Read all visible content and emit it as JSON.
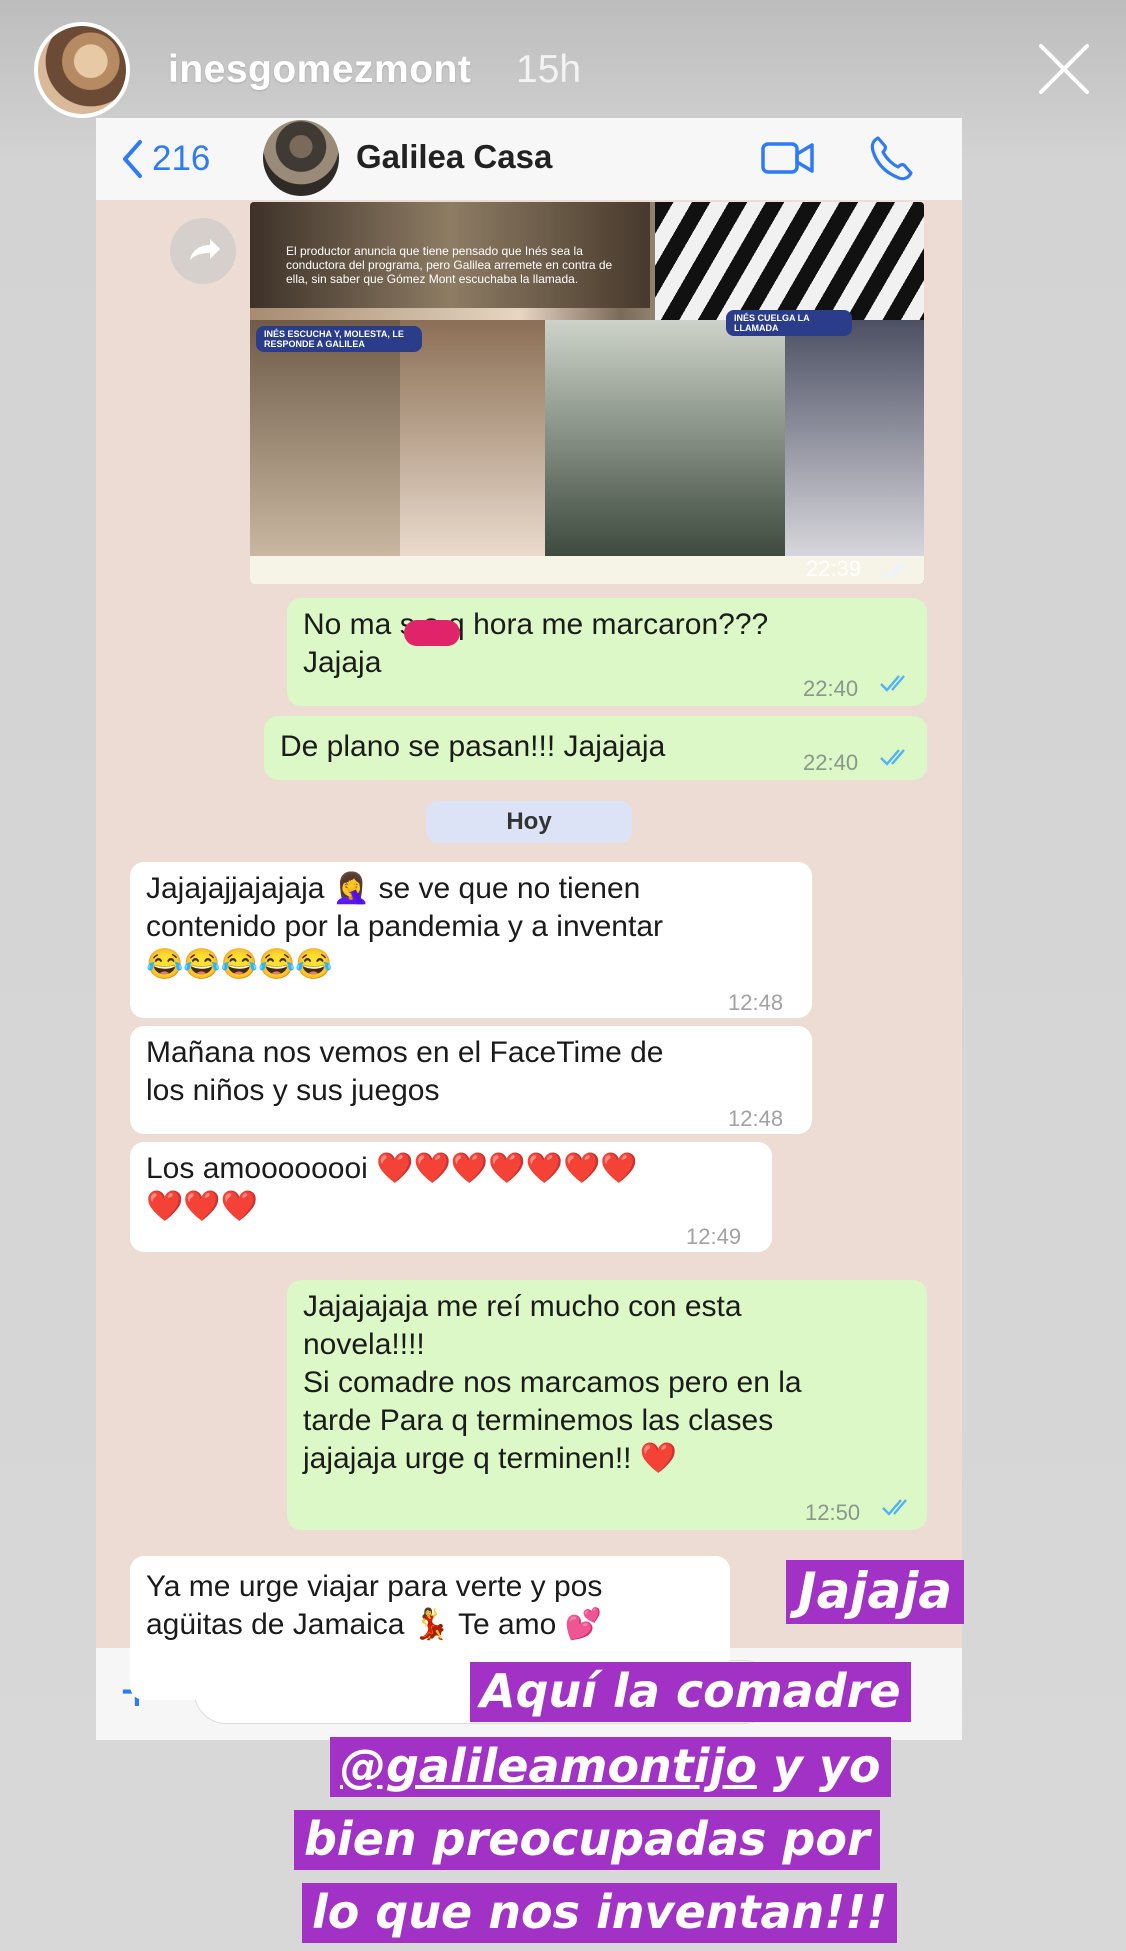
{
  "story": {
    "username": "inesgomezmont",
    "time": "15h",
    "stickers": {
      "line1": "Jajaja",
      "line2": "Aquí la comadre",
      "line3_mention": "@galileamontijo",
      "line3_rest": " y yo",
      "line4": "bien preocupadas por",
      "line5": "lo que nos inventan!!!"
    }
  },
  "chat": {
    "back_count": "216",
    "contact_name": "Galilea Casa",
    "image_caption": "El productor anuncia que tiene pensado que Inés sea la conductora del programa, pero Galilea arremete en contra de ella, sin saber que Gómez Mont escuchaba la llamada.",
    "image_tag_2": "INÉS ESCUCHA Y, MOLESTA, LE RESPONDE A GALILEA",
    "image_tag_3": "INÉS CUELGA LA LLAMADA",
    "image_time": "22:39",
    "day_label": "Hoy",
    "messages": [
      {
        "text": "No ma      s a q hora me marcaron???\nJajaja",
        "time": "22:40"
      },
      {
        "text": "De plano se pasan!!! Jajajaja",
        "time": "22:40"
      },
      {
        "text": "Jajajajjajajaja 🤦‍♀️ se ve que no tienen\ncontenido por la pandemia y a inventar\n😂😂😂😂😂",
        "time": "12:48"
      },
      {
        "text": "Mañana nos vemos en el FaceTime de\nlos niños y sus juegos",
        "time": "12:48"
      },
      {
        "text": "Los amoooooooi ❤️❤️❤️❤️❤️❤️❤️\n❤️❤️❤️",
        "time": "12:49"
      },
      {
        "text": "Jajajajaja me reí mucho con esta\nnovela!!!!\nSi comadre nos marcamos pero en la\ntarde Para q terminemos las clases\njajajaja urge q terminen!! ❤️",
        "time": "12:50"
      },
      {
        "text": "Ya me urge viajar para verte y pos\nagüitas de Jamaica 💃 Te amo 💕",
        "time": ""
      }
    ]
  },
  "colors": {
    "accent": "#2f7bf5",
    "outgoing_bubble": "#dcf8c6",
    "sticker": "#a232c6"
  }
}
